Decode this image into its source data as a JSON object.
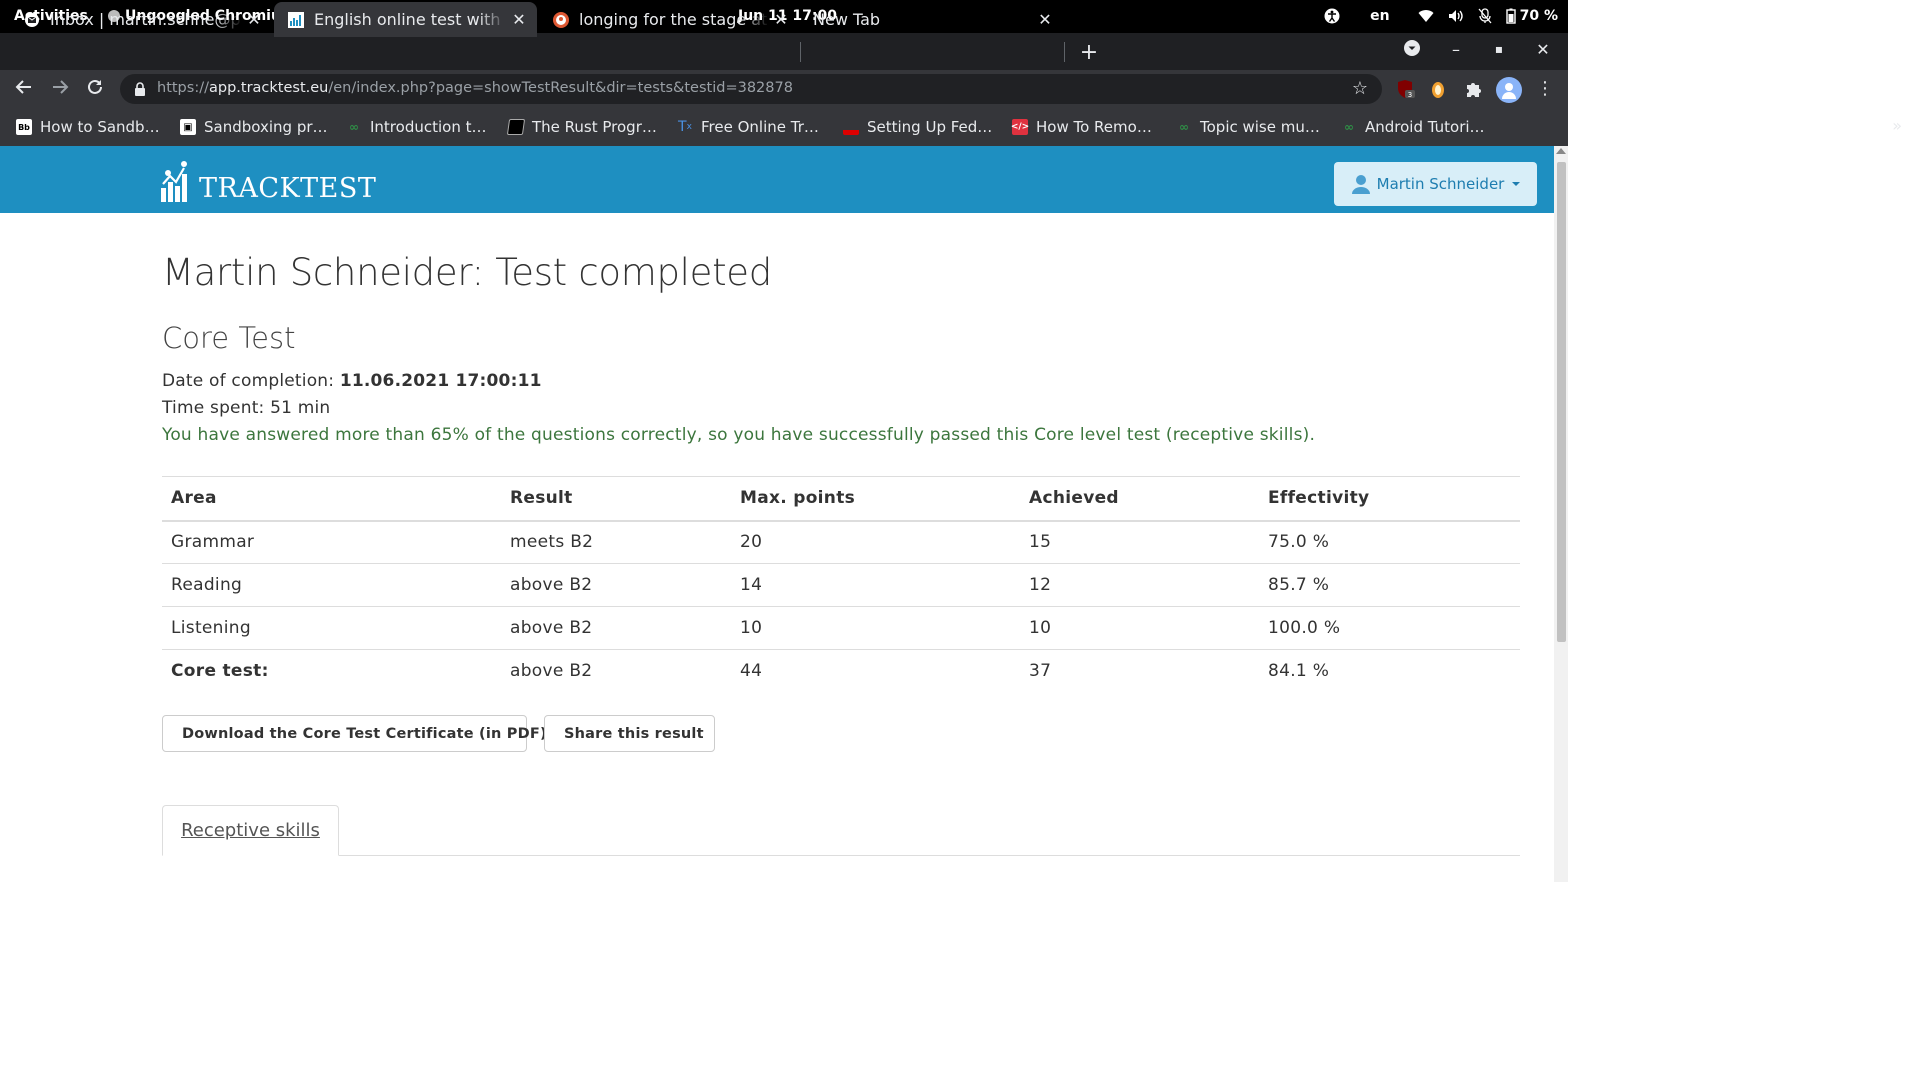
{
  "system": {
    "activities": "Activities",
    "app_name": "Ungoogled Chromium",
    "clock": "Jun 11  17:00",
    "language": "en",
    "battery": "70 %"
  },
  "tabs": [
    {
      "title": "Inbox | martin.schne@pro",
      "favicon": "mail-icon",
      "active": false
    },
    {
      "title": "English online test with ce",
      "favicon": "tracktest-icon",
      "active": true
    },
    {
      "title": "longing for the stage at Du",
      "favicon": "duckduckgo-icon",
      "active": false
    },
    {
      "title": "New Tab",
      "favicon": "",
      "active": false
    }
  ],
  "omnibox": {
    "url_prefix": "https://",
    "url_domain": "app.tracktest.eu",
    "url_path": "/en/index.php?page=showTestResult&dir=tests&testid=382878"
  },
  "bookmarks": [
    {
      "label": "How to Sandb…",
      "icon": "Bb"
    },
    {
      "label": "Sandboxing pr…",
      "icon": "sandbox"
    },
    {
      "label": "Introduction t…",
      "icon": "gfg"
    },
    {
      "label": "The Rust Progr…",
      "icon": "book"
    },
    {
      "label": "Free Online Tr…",
      "icon": "Tx"
    },
    {
      "label": "Setting Up Fed…",
      "icon": "flag"
    },
    {
      "label": "How To Remo…",
      "icon": "code"
    },
    {
      "label": "Topic wise mu…",
      "icon": "gfg"
    },
    {
      "label": "Android Tutori…",
      "icon": "gfg"
    }
  ],
  "bookmarks_more": "»",
  "site": {
    "brand": "TRACKTEST",
    "user_name": "Martin Schneider"
  },
  "page": {
    "heading": "Martin Schneider: Test completed",
    "subheading": "Core Test",
    "completion_label": "Date of completion: ",
    "completion_value": "11.06.2021 17:00:11",
    "time_spent": "Time spent: 51 min",
    "success_message": "You have answered more than 65% of the questions correctly, so you have successfully passed this Core level test (receptive skills)."
  },
  "results": {
    "headers": [
      "Area",
      "Result",
      "Max. points",
      "Achieved",
      "Effectivity"
    ],
    "rows": [
      [
        "Grammar",
        "meets B2",
        "20",
        "15",
        "75.0 %"
      ],
      [
        "Reading",
        "above B2",
        "14",
        "12",
        "85.7 %"
      ],
      [
        "Listening",
        "above B2",
        "10",
        "10",
        "100.0 %"
      ],
      [
        "Core test:",
        "above B2",
        "44",
        "37",
        "84.1 %"
      ]
    ]
  },
  "actions": {
    "download_label": "Download the Core Test Certificate (in PDF)",
    "share_label": "Share this result"
  },
  "section_tabs": {
    "receptive": "Receptive skills"
  }
}
